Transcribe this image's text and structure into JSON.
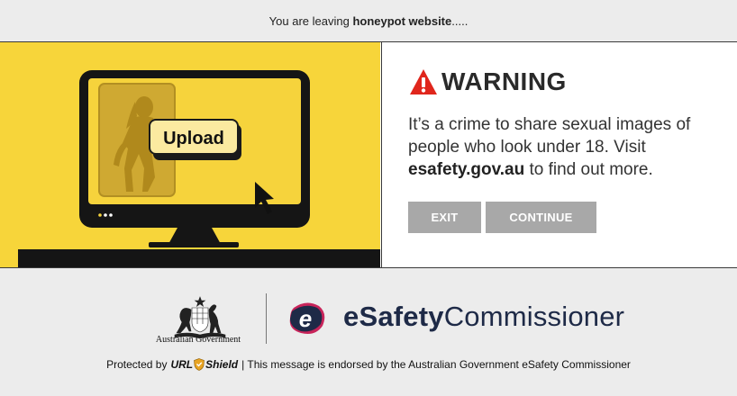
{
  "top_bar": {
    "prefix": "You are leaving ",
    "site_name": "honeypot website",
    "suffix": "....."
  },
  "illustration": {
    "upload_label": "Upload"
  },
  "warning": {
    "title": "WARNING",
    "text_before": "It’s a crime to share sexual images of people who look under 18. Visit ",
    "link_text": "esafety.gov.au",
    "text_after": " to find out more."
  },
  "buttons": {
    "exit_label": "EXIT",
    "continue_label": "CONTINUE"
  },
  "footer": {
    "gov_label": "Australian Government",
    "esafety_bold": "eSafety",
    "esafety_rest": "Commissioner",
    "protected_prefix": "Protected by",
    "urlshield_url": "URL",
    "urlshield_shield": "Shield",
    "protected_suffix": "| This message is endorsed by the Australian Government eSafety Commissioner"
  },
  "colors": {
    "illustration_bg": "#f7d53a",
    "button_bg": "#a8a8a8",
    "warning_red": "#e0261c",
    "esafety_navy": "#1e2a47",
    "esafety_magenta": "#c8245a"
  },
  "icons": {
    "warning": "warning-triangle-icon",
    "cursor": "cursor-arrow-icon",
    "shield": "shield-icon"
  }
}
